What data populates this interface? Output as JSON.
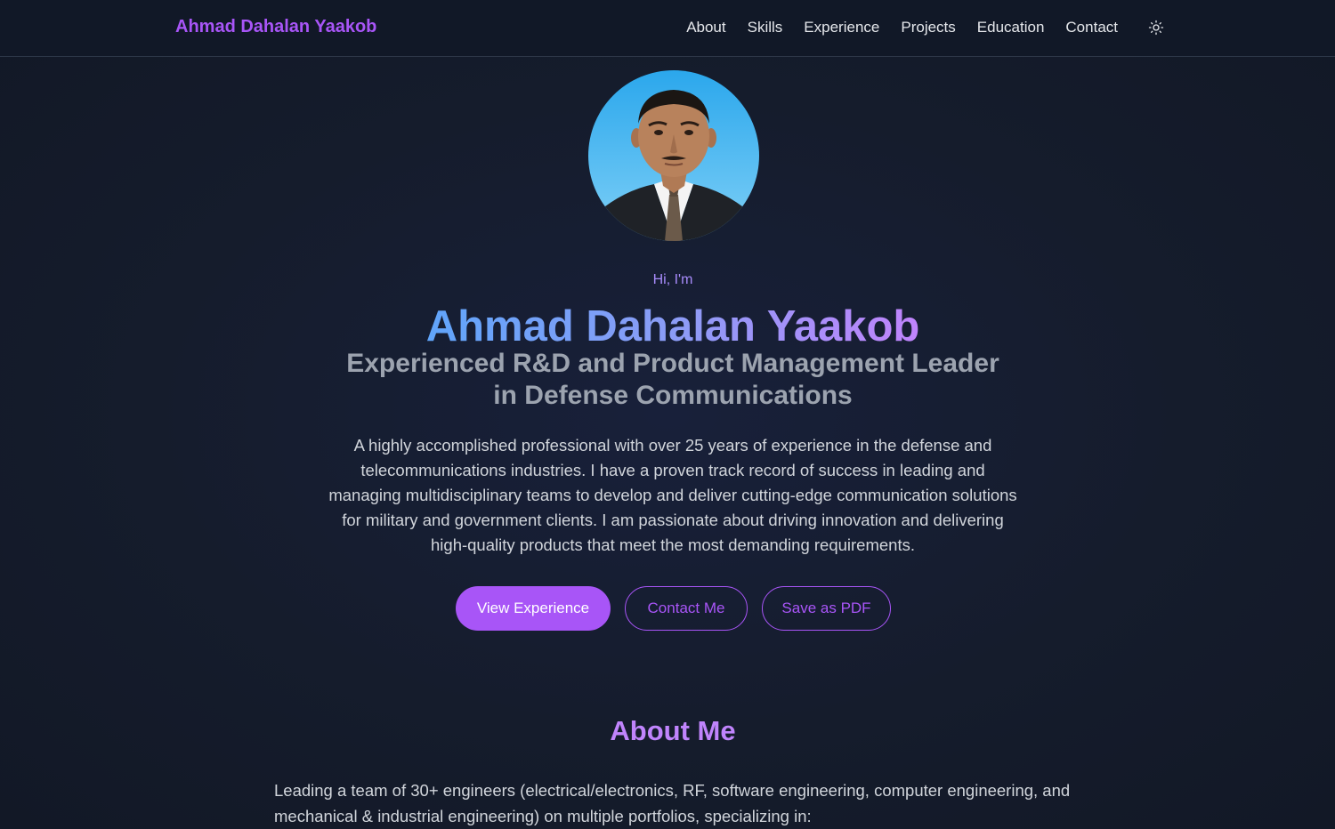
{
  "nav": {
    "brand": "Ahmad Dahalan Yaakob",
    "links": [
      "About",
      "Skills",
      "Experience",
      "Projects",
      "Education",
      "Contact"
    ],
    "theme_icon": "sun-icon"
  },
  "hero": {
    "greeting": "Hi, I'm",
    "name": "Ahmad Dahalan Yaakob",
    "title": "Experienced R&D and Product Management Leader in Defense Communications",
    "description": "A highly accomplished professional with over 25 years of experience in the defense and telecommunications industries. I have a proven track record of success in leading and managing multidisciplinary teams to develop and deliver cutting-edge communication solutions for military and government clients. I am passionate about driving innovation and delivering high-quality products that meet the most demanding requirements.",
    "buttons": {
      "view_experience": "View Experience",
      "contact": "Contact Me",
      "save_pdf": "Save as PDF"
    }
  },
  "about": {
    "title": "About Me",
    "intro": "Leading a team of 30+ engineers (electrical/electronics, RF, software engineering, computer engineering, and mechanical & industrial engineering) on multiple portfolios, specializing in:"
  },
  "colors": {
    "accent": "#a855f7",
    "background": "#151c2c",
    "navbar": "#111827",
    "gradient_start": "#60a5fa",
    "gradient_end": "#c084fc"
  }
}
